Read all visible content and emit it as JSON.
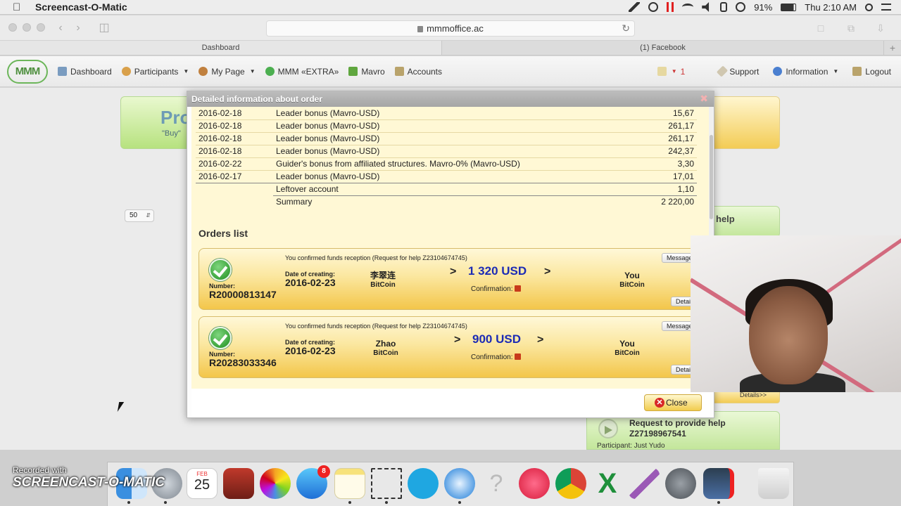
{
  "menubar": {
    "app_name": "Screencast-O-Matic",
    "battery": "91%",
    "clock": "Thu 2:10 AM"
  },
  "browser": {
    "url": "mmmoffice.ac",
    "tabs": [
      {
        "label": "Dashboard"
      },
      {
        "label": "(1) Facebook"
      }
    ]
  },
  "sitenav": {
    "logo": "MMM",
    "items": [
      {
        "label": "Dashboard",
        "icon": "dashboard-icon",
        "color": "#7a9cc0"
      },
      {
        "label": "Participants",
        "icon": "participants-icon",
        "color": "#d9a04a"
      },
      {
        "label": "My Page",
        "icon": "user-icon",
        "color": "#c0803e"
      },
      {
        "label": "MMM «EXTRA»",
        "icon": "extra-icon",
        "color": "#4caf50"
      },
      {
        "label": "Mavro",
        "icon": "mavro-icon",
        "color": "#5fa63e"
      },
      {
        "label": "Accounts",
        "icon": "accounts-icon",
        "color": "#b9a36b"
      }
    ],
    "mail_count": "1",
    "right_items": [
      {
        "label": "Support"
      },
      {
        "label": "Information"
      },
      {
        "label": "Logout"
      }
    ]
  },
  "background": {
    "promo_title": "Pro",
    "promo_sub": "\"Buy\"",
    "help_label": "help",
    "details_label": "Details>>",
    "request_title": "Request to provide help",
    "request_number": "Z27198967541",
    "request_participant": "Participant: Just Yudo",
    "per_page": "50"
  },
  "modal": {
    "title": "Detailed information about order",
    "transactions": [
      {
        "date": "2016-02-18",
        "desc": "Leader bonus (Mavro-USD)",
        "amount": "15,67"
      },
      {
        "date": "2016-02-18",
        "desc": "Leader bonus (Mavro-USD)",
        "amount": "261,17"
      },
      {
        "date": "2016-02-18",
        "desc": "Leader bonus (Mavro-USD)",
        "amount": "261,17"
      },
      {
        "date": "2016-02-18",
        "desc": "Leader bonus (Mavro-USD)",
        "amount": "242,37"
      },
      {
        "date": "2016-02-22",
        "desc": "Guider's bonus from affiliated structures. Mavro-0% (Mavro-USD)",
        "amount": "3,30"
      },
      {
        "date": "2016-02-17",
        "desc": "Leader bonus (Mavro-USD)",
        "amount": "17,01"
      },
      {
        "date": "",
        "desc": "Leftover account",
        "amount": "1,10"
      },
      {
        "date": "",
        "desc": "Summary",
        "amount": "2 220,00"
      }
    ],
    "orders_title": "Orders list",
    "orders": [
      {
        "confirmed": "You confirmed funds reception (Request for help Z23104674745)",
        "messages": "Messages: 1",
        "number_label": "Number:",
        "number": "R20000813147",
        "date_label": "Date of creating:",
        "date": "2016-02-23",
        "sender": "李翠连",
        "sender_method": "BitCoin",
        "amount": "1 320 USD",
        "confirmation_label": "Confirmation:",
        "receiver": "You",
        "receiver_method": "BitCoin",
        "details": "Details>>"
      },
      {
        "confirmed": "You confirmed funds reception (Request for help Z23104674745)",
        "messages": "Messages: 1",
        "number_label": "Number:",
        "number": "R20283033346",
        "date_label": "Date of creating:",
        "date": "2016-02-23",
        "sender": "Zhao",
        "sender_method": "BitCoin",
        "amount": "900 USD",
        "confirmation_label": "Confirmation:",
        "receiver": "You",
        "receiver_method": "BitCoin",
        "details": "Details>>"
      }
    ],
    "close_label": "Close"
  },
  "dock": {
    "calendar_month": "FEB",
    "calendar_day": "25",
    "appstore_badge": "8",
    "icons": [
      "finder-icon",
      "launchpad-icon",
      "calendar-icon",
      "photo-booth-icon",
      "photos-icon",
      "app-store-icon",
      "notes-icon",
      "screenshot-icon",
      "skype-icon",
      "safari-icon",
      "help-icon",
      "itunes-icon",
      "chrome-icon",
      "excel-icon",
      "feather-icon",
      "system-preferences-icon",
      "screencast-icon",
      "trash-icon"
    ]
  },
  "watermark": {
    "line1": "Recorded with",
    "line2": "SCREENCAST-O-MATIC"
  }
}
